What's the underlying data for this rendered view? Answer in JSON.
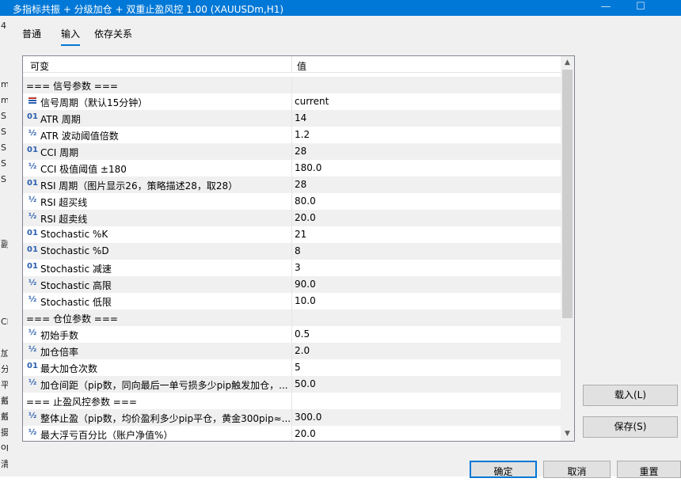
{
  "window": {
    "title": "多指标共振 + 分级加仓 + 双重止盈风控 1.00 (XAUUSDm,H1)",
    "minimize_glyph": "—",
    "maximize_glyph": "☐"
  },
  "background_fragments": [
    "4",
    "m",
    "m",
    "S",
    "S",
    "S",
    "S",
    "S",
    "副",
    "CN",
    "加",
    "分",
    "平",
    "戴",
    "戴",
    "摄",
    "op",
    "清"
  ],
  "tabs": [
    {
      "label": "普通",
      "active": false
    },
    {
      "label": "输入",
      "active": true
    },
    {
      "label": "依存关系",
      "active": false
    }
  ],
  "grid": {
    "header": {
      "variable": "可变",
      "value": "值"
    },
    "rows": [
      {
        "type": "section",
        "name": "=== 信号参数 ===",
        "value": ""
      },
      {
        "type": "enum",
        "icon": "enum-icon",
        "name": "信号周期（默认15分钟）",
        "value": "current"
      },
      {
        "type": "int",
        "icon": "integer-icon",
        "icon_glyph": "01",
        "name": "ATR 周期",
        "value": "14"
      },
      {
        "type": "double",
        "icon": "double-icon",
        "icon_glyph": "½",
        "name": "ATR 波动阈值倍数",
        "value": "1.2"
      },
      {
        "type": "int",
        "icon": "integer-icon",
        "icon_glyph": "01",
        "name": "CCI 周期",
        "value": "28"
      },
      {
        "type": "double",
        "icon": "double-icon",
        "icon_glyph": "½",
        "name": "CCI 极值阈值 ±180",
        "value": "180.0"
      },
      {
        "type": "int",
        "icon": "integer-icon",
        "icon_glyph": "01",
        "name": "RSI 周期（图片显示26，策略描述28，取28）",
        "value": "28"
      },
      {
        "type": "double",
        "icon": "double-icon",
        "icon_glyph": "½",
        "name": "RSI 超买线",
        "value": "80.0"
      },
      {
        "type": "double",
        "icon": "double-icon",
        "icon_glyph": "½",
        "name": "RSI 超卖线",
        "value": "20.0"
      },
      {
        "type": "int",
        "icon": "integer-icon",
        "icon_glyph": "01",
        "name": "Stochastic %K",
        "value": "21"
      },
      {
        "type": "int",
        "icon": "integer-icon",
        "icon_glyph": "01",
        "name": "Stochastic %D",
        "value": "8"
      },
      {
        "type": "int",
        "icon": "integer-icon",
        "icon_glyph": "01",
        "name": "Stochastic 减速",
        "value": "3"
      },
      {
        "type": "double",
        "icon": "double-icon",
        "icon_glyph": "½",
        "name": "Stochastic 高限",
        "value": "90.0"
      },
      {
        "type": "double",
        "icon": "double-icon",
        "icon_glyph": "½",
        "name": "Stochastic 低限",
        "value": "10.0"
      },
      {
        "type": "section",
        "name": "=== 仓位参数 ===",
        "value": ""
      },
      {
        "type": "double",
        "icon": "double-icon",
        "icon_glyph": "½",
        "name": "初始手数",
        "value": "0.5"
      },
      {
        "type": "double",
        "icon": "double-icon",
        "icon_glyph": "½",
        "name": "加仓倍率",
        "value": "2.0"
      },
      {
        "type": "int",
        "icon": "integer-icon",
        "icon_glyph": "01",
        "name": "最大加仓次数",
        "value": "5"
      },
      {
        "type": "double",
        "icon": "double-icon",
        "icon_glyph": "½",
        "name": "加仓间距（pip数，同向最后一单亏损多少pip触发加仓，...",
        "value": "50.0"
      },
      {
        "type": "section",
        "name": "=== 止盈风控参数 ===",
        "value": ""
      },
      {
        "type": "double",
        "icon": "double-icon",
        "icon_glyph": "½",
        "name": "整体止盈（pip数，均价盈利多少pip平仓，黄金300pip≈...",
        "value": "300.0"
      },
      {
        "type": "double",
        "icon": "double-icon",
        "icon_glyph": "½",
        "name": "最大浮亏百分比（账户净值%）",
        "value": "20.0"
      }
    ]
  },
  "buttons": {
    "load": "载入(L)",
    "save": "保存(S)",
    "ok": "确定",
    "cancel": "取消",
    "reset": "重置"
  },
  "colors": {
    "titlebar": "#0078d7",
    "accent": "#0078d7",
    "icon": "#2a5fb0",
    "row_alt": "#f0f0f0"
  }
}
